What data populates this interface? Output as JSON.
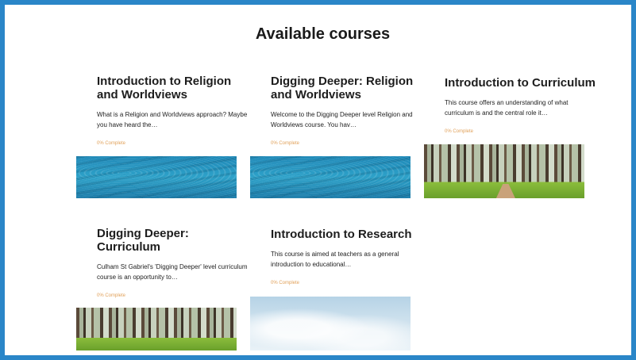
{
  "page": {
    "title": "Available courses"
  },
  "courses": [
    {
      "title": "Introduction to Religion and Worldviews",
      "description": "What is a Religion and Worldviews approach? Maybe you have heard the…",
      "progress": "0% Complete",
      "image": "water-texture"
    },
    {
      "title": "Digging Deeper: Religion and Worldviews",
      "description": "Welcome to the Digging Deeper level Religion and Worldviews course. You hav…",
      "progress": "0% Complete",
      "image": "water-texture"
    },
    {
      "title": "Introduction to Curriculum",
      "description": "This course offers an understanding of what curriculum is and the central role it…",
      "progress": "0% Complete",
      "image": "forest-photo"
    },
    {
      "title": "Digging Deeper: Curriculum",
      "description": "Culham St Gabriel's 'Digging Deeper' level curriculum course is an opportunity to…",
      "progress": "0% Complete",
      "image": "forest-photo"
    },
    {
      "title": "Introduction to Research",
      "description": "This course is aimed at teachers as a general introduction to educational…",
      "progress": "0% Complete",
      "image": "sky-photo"
    }
  ],
  "colors": {
    "frame_border": "#2a86c8",
    "progress_text": "#e1a15a"
  }
}
